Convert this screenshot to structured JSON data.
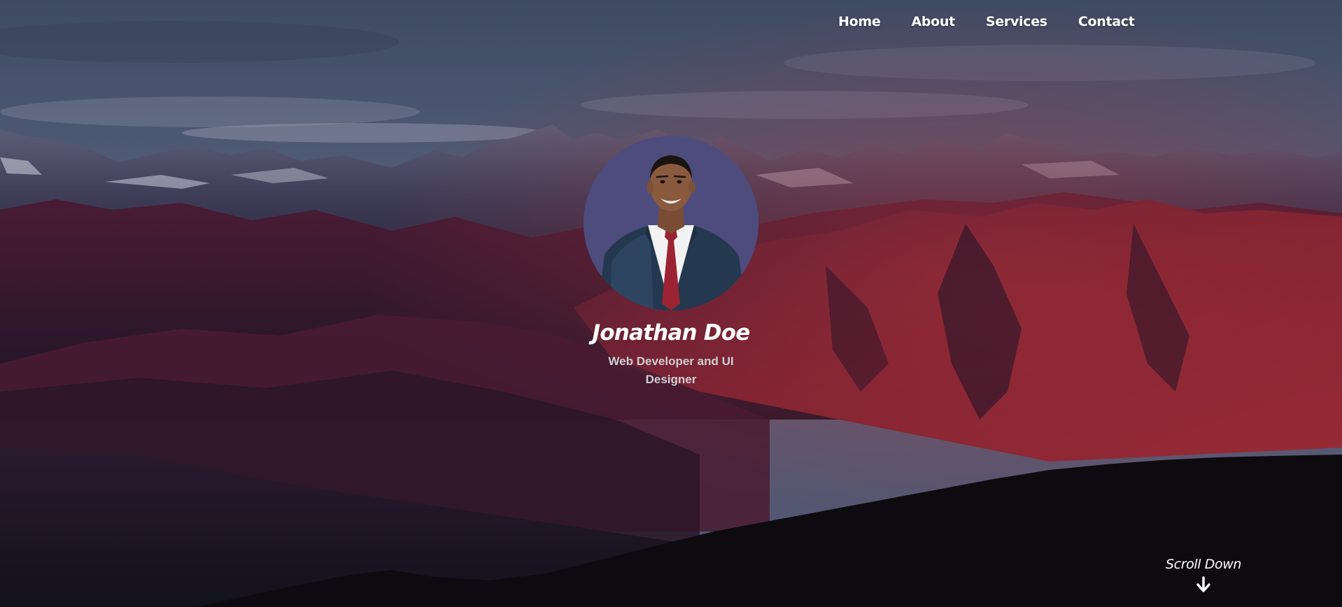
{
  "nav": {
    "items": [
      {
        "label": "Home"
      },
      {
        "label": "About"
      },
      {
        "label": "Services"
      },
      {
        "label": "Contact"
      }
    ]
  },
  "profile": {
    "name": "Jonathan Doe",
    "role": "Web Developer and UI Designer",
    "photo_icon": "person-portrait-icon"
  },
  "scroll": {
    "label": "Scroll Down",
    "icon": "arrow-down-icon"
  },
  "colors": {
    "text": "#ffffff",
    "role_text": "#cfcfd3",
    "avatar_bg": "#4d4c7d",
    "mountain_red": "#8a2233",
    "sky": "#4a5570"
  }
}
